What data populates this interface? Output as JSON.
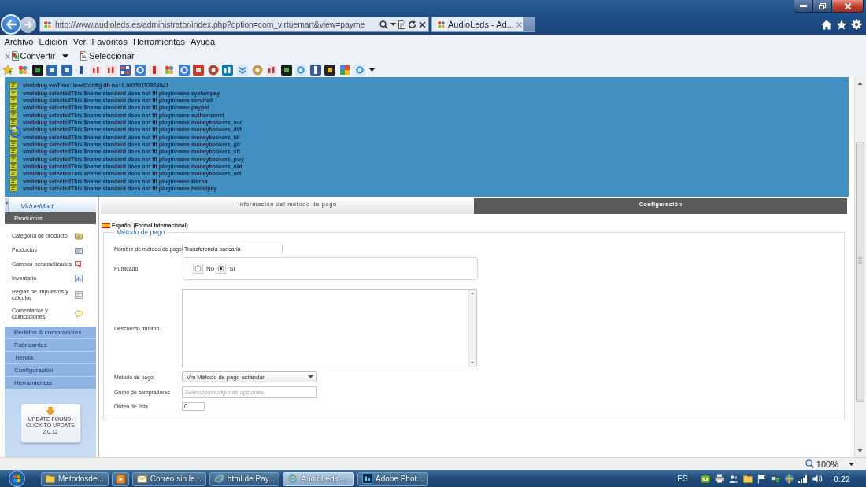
{
  "browser": {
    "address": "http://www.audioleds.es/administrator/index.php?option=com_virtuemart&view=payme",
    "tabs": [
      {
        "title": "AudioLeds - Ad...",
        "selected": true
      }
    ],
    "menu": [
      "Archivo",
      "Edición",
      "Ver",
      "Favoritos",
      "Herramientas",
      "Ayuda"
    ],
    "command_bar": {
      "close": "x",
      "items": [
        {
          "label": "Convertir",
          "dropdown": true
        },
        {
          "label": "Seleccionar",
          "dropdown": false
        }
      ]
    },
    "zoom": "100%"
  },
  "debug_log": [
    "vmdebug vmTime: loadConfig db no: 0.00251157814941",
    "vmdebug selectedThis $name standard does not fit pluginname systempay",
    "vmdebug selectedThis $name standard does not fit pluginname servired",
    "vmdebug selectedThis $name standard does not fit pluginname paypal",
    "vmdebug selectedThis $name standard does not fit pluginname authorizenet",
    "vmdebug selectedThis $name standard does not fit pluginname moneybookers_acc",
    "vmdebug selectedThis $name standard does not fit pluginname moneybookers_did",
    "vmdebug selectedThis $name standard does not fit pluginname moneybookers_idl",
    "vmdebug selectedThis $name standard does not fit pluginname moneybookers_gir",
    "vmdebug selectedThis $name standard does not fit pluginname moneybookers_sft",
    "vmdebug selectedThis $name standard does not fit pluginname moneybookers_pwy",
    "vmdebug selectedThis $name standard does not fit pluginname moneybookers_obt",
    "vmdebug selectedThis $name standard does not fit pluginname moneybookers_wlt",
    "vmdebug selectedThis $name standard does not fit pluginname klarna",
    "vmdebug selectedThis $name standard does not fit pluginname heidelpay"
  ],
  "sidebar": {
    "logo": "VirtueMart",
    "sections": [
      {
        "title": "Productos",
        "expanded": true,
        "items": [
          "Categoría de producto",
          "Productos",
          "Campos personalizados",
          "Inventario",
          "Reglas de impuestos y cálculos",
          "Comentarios y calificaciones"
        ]
      },
      {
        "title": "Pedidos & compradores",
        "expanded": false
      },
      {
        "title": "Fabricantes",
        "expanded": false
      },
      {
        "title": "Tienda",
        "expanded": false
      },
      {
        "title": "Configuración",
        "expanded": false
      },
      {
        "title": "Herramientas",
        "expanded": false
      }
    ],
    "update_button": {
      "lines": [
        "UPDATE FOUND!",
        "CLICK TO UPDATE",
        "2.0.12"
      ]
    }
  },
  "tabs": [
    {
      "label": "Información del método de pago",
      "selected": true
    },
    {
      "label": "Configuración",
      "selected": false
    }
  ],
  "language": "Español (Formal Internacional)",
  "form": {
    "legend": "Método de pago",
    "fields": [
      {
        "kind": "text",
        "label": "Nombre de método de pago",
        "value": "Transferencia bancaria"
      },
      {
        "kind": "radio",
        "label": "Publicado",
        "options": [
          {
            "label": "No",
            "selected": false
          },
          {
            "label": "Si",
            "selected": true
          }
        ]
      },
      {
        "kind": "textarea",
        "label": "Descuento mínimo"
      },
      {
        "kind": "select",
        "label": "Método de pago",
        "value": "Vm Método de pago estándar"
      },
      {
        "kind": "multiselect",
        "label": "Grupo de compradores",
        "placeholder": "Seleccionar algunas opciones"
      },
      {
        "kind": "short",
        "label": "Orden de lista",
        "value": "0"
      }
    ]
  },
  "taskbar": {
    "buttons": [
      {
        "kind": "folder",
        "label": "Metodosde...",
        "selected": false
      },
      {
        "kind": "media",
        "selected": false
      },
      {
        "kind": "mail",
        "label": "Correo sin le...",
        "selected": false
      },
      {
        "kind": "browser",
        "label": "html de Pay...",
        "selected": false
      },
      {
        "kind": "browser",
        "label": "AudioLeds -...",
        "selected": true
      },
      {
        "kind": "image",
        "label": "Adobe Phot...",
        "selected": false
      }
    ],
    "language": "ES",
    "clock": "0:22"
  }
}
